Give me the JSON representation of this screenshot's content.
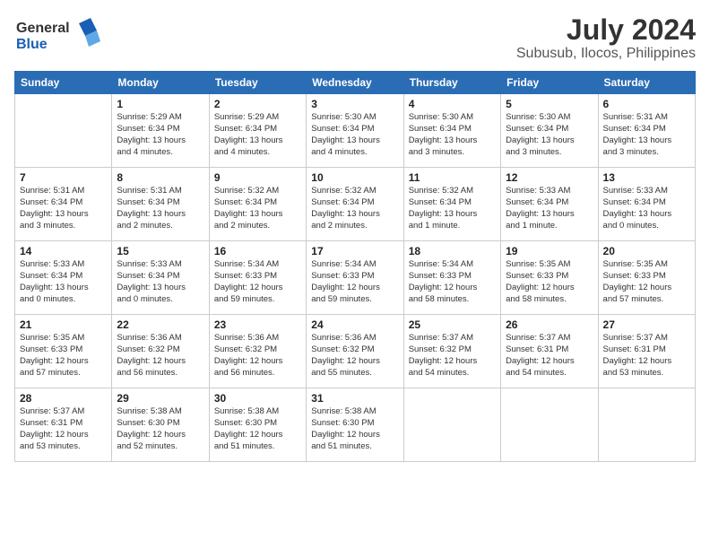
{
  "header": {
    "logo_line1": "General",
    "logo_line2": "Blue",
    "title": "July 2024",
    "subtitle": "Subusub, Ilocos, Philippines"
  },
  "calendar": {
    "headers": [
      "Sunday",
      "Monday",
      "Tuesday",
      "Wednesday",
      "Thursday",
      "Friday",
      "Saturday"
    ],
    "weeks": [
      [
        {
          "day": "",
          "info": ""
        },
        {
          "day": "1",
          "info": "Sunrise: 5:29 AM\nSunset: 6:34 PM\nDaylight: 13 hours\nand 4 minutes."
        },
        {
          "day": "2",
          "info": "Sunrise: 5:29 AM\nSunset: 6:34 PM\nDaylight: 13 hours\nand 4 minutes."
        },
        {
          "day": "3",
          "info": "Sunrise: 5:30 AM\nSunset: 6:34 PM\nDaylight: 13 hours\nand 4 minutes."
        },
        {
          "day": "4",
          "info": "Sunrise: 5:30 AM\nSunset: 6:34 PM\nDaylight: 13 hours\nand 3 minutes."
        },
        {
          "day": "5",
          "info": "Sunrise: 5:30 AM\nSunset: 6:34 PM\nDaylight: 13 hours\nand 3 minutes."
        },
        {
          "day": "6",
          "info": "Sunrise: 5:31 AM\nSunset: 6:34 PM\nDaylight: 13 hours\nand 3 minutes."
        }
      ],
      [
        {
          "day": "7",
          "info": "Sunrise: 5:31 AM\nSunset: 6:34 PM\nDaylight: 13 hours\nand 3 minutes."
        },
        {
          "day": "8",
          "info": "Sunrise: 5:31 AM\nSunset: 6:34 PM\nDaylight: 13 hours\nand 2 minutes."
        },
        {
          "day": "9",
          "info": "Sunrise: 5:32 AM\nSunset: 6:34 PM\nDaylight: 13 hours\nand 2 minutes."
        },
        {
          "day": "10",
          "info": "Sunrise: 5:32 AM\nSunset: 6:34 PM\nDaylight: 13 hours\nand 2 minutes."
        },
        {
          "day": "11",
          "info": "Sunrise: 5:32 AM\nSunset: 6:34 PM\nDaylight: 13 hours\nand 1 minute."
        },
        {
          "day": "12",
          "info": "Sunrise: 5:33 AM\nSunset: 6:34 PM\nDaylight: 13 hours\nand 1 minute."
        },
        {
          "day": "13",
          "info": "Sunrise: 5:33 AM\nSunset: 6:34 PM\nDaylight: 13 hours\nand 0 minutes."
        }
      ],
      [
        {
          "day": "14",
          "info": "Sunrise: 5:33 AM\nSunset: 6:34 PM\nDaylight: 13 hours\nand 0 minutes."
        },
        {
          "day": "15",
          "info": "Sunrise: 5:33 AM\nSunset: 6:34 PM\nDaylight: 13 hours\nand 0 minutes."
        },
        {
          "day": "16",
          "info": "Sunrise: 5:34 AM\nSunset: 6:33 PM\nDaylight: 12 hours\nand 59 minutes."
        },
        {
          "day": "17",
          "info": "Sunrise: 5:34 AM\nSunset: 6:33 PM\nDaylight: 12 hours\nand 59 minutes."
        },
        {
          "day": "18",
          "info": "Sunrise: 5:34 AM\nSunset: 6:33 PM\nDaylight: 12 hours\nand 58 minutes."
        },
        {
          "day": "19",
          "info": "Sunrise: 5:35 AM\nSunset: 6:33 PM\nDaylight: 12 hours\nand 58 minutes."
        },
        {
          "day": "20",
          "info": "Sunrise: 5:35 AM\nSunset: 6:33 PM\nDaylight: 12 hours\nand 57 minutes."
        }
      ],
      [
        {
          "day": "21",
          "info": "Sunrise: 5:35 AM\nSunset: 6:33 PM\nDaylight: 12 hours\nand 57 minutes."
        },
        {
          "day": "22",
          "info": "Sunrise: 5:36 AM\nSunset: 6:32 PM\nDaylight: 12 hours\nand 56 minutes."
        },
        {
          "day": "23",
          "info": "Sunrise: 5:36 AM\nSunset: 6:32 PM\nDaylight: 12 hours\nand 56 minutes."
        },
        {
          "day": "24",
          "info": "Sunrise: 5:36 AM\nSunset: 6:32 PM\nDaylight: 12 hours\nand 55 minutes."
        },
        {
          "day": "25",
          "info": "Sunrise: 5:37 AM\nSunset: 6:32 PM\nDaylight: 12 hours\nand 54 minutes."
        },
        {
          "day": "26",
          "info": "Sunrise: 5:37 AM\nSunset: 6:31 PM\nDaylight: 12 hours\nand 54 minutes."
        },
        {
          "day": "27",
          "info": "Sunrise: 5:37 AM\nSunset: 6:31 PM\nDaylight: 12 hours\nand 53 minutes."
        }
      ],
      [
        {
          "day": "28",
          "info": "Sunrise: 5:37 AM\nSunset: 6:31 PM\nDaylight: 12 hours\nand 53 minutes."
        },
        {
          "day": "29",
          "info": "Sunrise: 5:38 AM\nSunset: 6:30 PM\nDaylight: 12 hours\nand 52 minutes."
        },
        {
          "day": "30",
          "info": "Sunrise: 5:38 AM\nSunset: 6:30 PM\nDaylight: 12 hours\nand 51 minutes."
        },
        {
          "day": "31",
          "info": "Sunrise: 5:38 AM\nSunset: 6:30 PM\nDaylight: 12 hours\nand 51 minutes."
        },
        {
          "day": "",
          "info": ""
        },
        {
          "day": "",
          "info": ""
        },
        {
          "day": "",
          "info": ""
        }
      ]
    ]
  }
}
